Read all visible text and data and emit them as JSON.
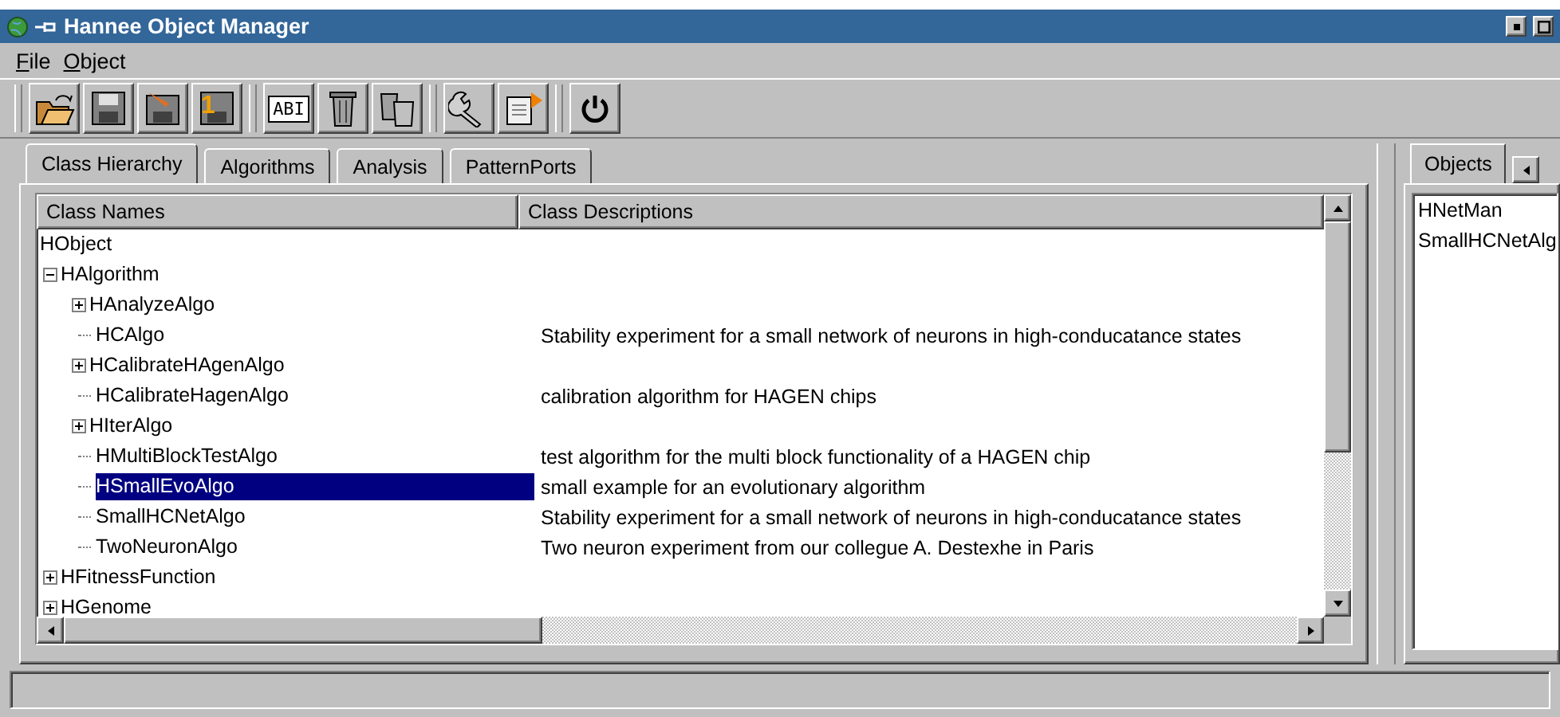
{
  "window": {
    "title": "Hannee Object Manager"
  },
  "menu": [
    {
      "label": "File"
    },
    {
      "label": "Object"
    }
  ],
  "toolbar": [
    {
      "buttons": [
        {
          "kind": "open"
        },
        {
          "kind": "save"
        },
        {
          "kind": "saveas"
        },
        {
          "kind": "saveone",
          "badge": "1"
        }
      ]
    },
    {
      "buttons": [
        {
          "kind": "text",
          "label": "ABI"
        },
        {
          "kind": "trash"
        },
        {
          "kind": "trashall"
        }
      ]
    },
    {
      "buttons": [
        {
          "kind": "wrench"
        },
        {
          "kind": "export"
        }
      ]
    },
    {
      "buttons": [
        {
          "kind": "power"
        }
      ]
    }
  ],
  "tabs": [
    {
      "label": "Class Hierarchy",
      "selected": true
    },
    {
      "label": "Algorithms",
      "selected": false
    },
    {
      "label": "Analysis",
      "selected": false
    },
    {
      "label": "PatternPorts",
      "selected": false
    }
  ],
  "table": {
    "columns": [
      "Class Names",
      "Class Descriptions"
    ],
    "tree": [
      {
        "name": "HObject",
        "selected": false,
        "children": [
          {
            "name": "HAlgorithm",
            "expanded": true,
            "selected": false,
            "children": [
              {
                "name": "HAnalyzeAlgo",
                "expanded": false,
                "selected": false
              },
              {
                "name": "HCAlgo",
                "description": "Stability experiment for a small network of neurons in high-conducatance states",
                "selected": false
              },
              {
                "name": "HCalibrateHAgenAlgo",
                "expanded": false,
                "selected": false
              },
              {
                "name": "HCalibrateHagenAlgo",
                "description": "calibration algorithm for HAGEN chips",
                "selected": false
              },
              {
                "name": "HIterAlgo",
                "expanded": false,
                "selected": false
              },
              {
                "name": "HMultiBlockTestAlgo",
                "description": "test algorithm for the multi block functionality of a HAGEN chip",
                "selected": false
              },
              {
                "name": "HSmallEvoAlgo",
                "description": "small example for an evolutionary algorithm",
                "selected": true
              },
              {
                "name": "SmallHCNetAlgo",
                "description": "Stability experiment for a small network of neurons in high-conducatance states",
                "selected": false
              },
              {
                "name": "TwoNeuronAlgo",
                "description": "Two neuron experiment from our collegue A. Destexhe in Paris",
                "selected": false
              }
            ]
          },
          {
            "name": "HFitnessFunction",
            "expanded": false,
            "selected": false
          },
          {
            "name": "HGenome",
            "expanded": false,
            "selected": false
          }
        ]
      }
    ]
  },
  "objects_panel": {
    "tab": {
      "label": "Objects",
      "selected": true
    },
    "items": [
      {
        "name": "HNetMan",
        "selected": false
      },
      {
        "name": "SmallHCNetAlg",
        "selected": false
      }
    ]
  }
}
